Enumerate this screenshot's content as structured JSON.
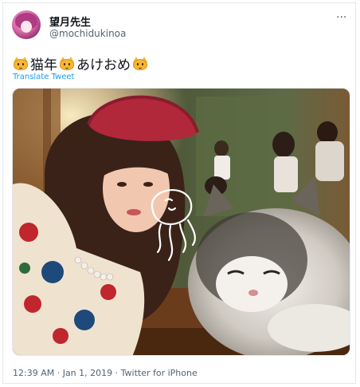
{
  "tweet": {
    "display_name": "望月先生",
    "handle": "@mochidukinoa",
    "more_label": "···",
    "text_parts": [
      "猫年",
      "あけおめ"
    ],
    "cat_emoji_icon": "smiling-cat-emoji",
    "translate_label": "Translate Tweet",
    "timestamp": "12:39 AM · Jan 1, 2019 · Twitter for iPhone"
  },
  "colors": {
    "link": "#1d9bf0",
    "secondary_text": "#536471",
    "border": "#e1e8ed"
  }
}
